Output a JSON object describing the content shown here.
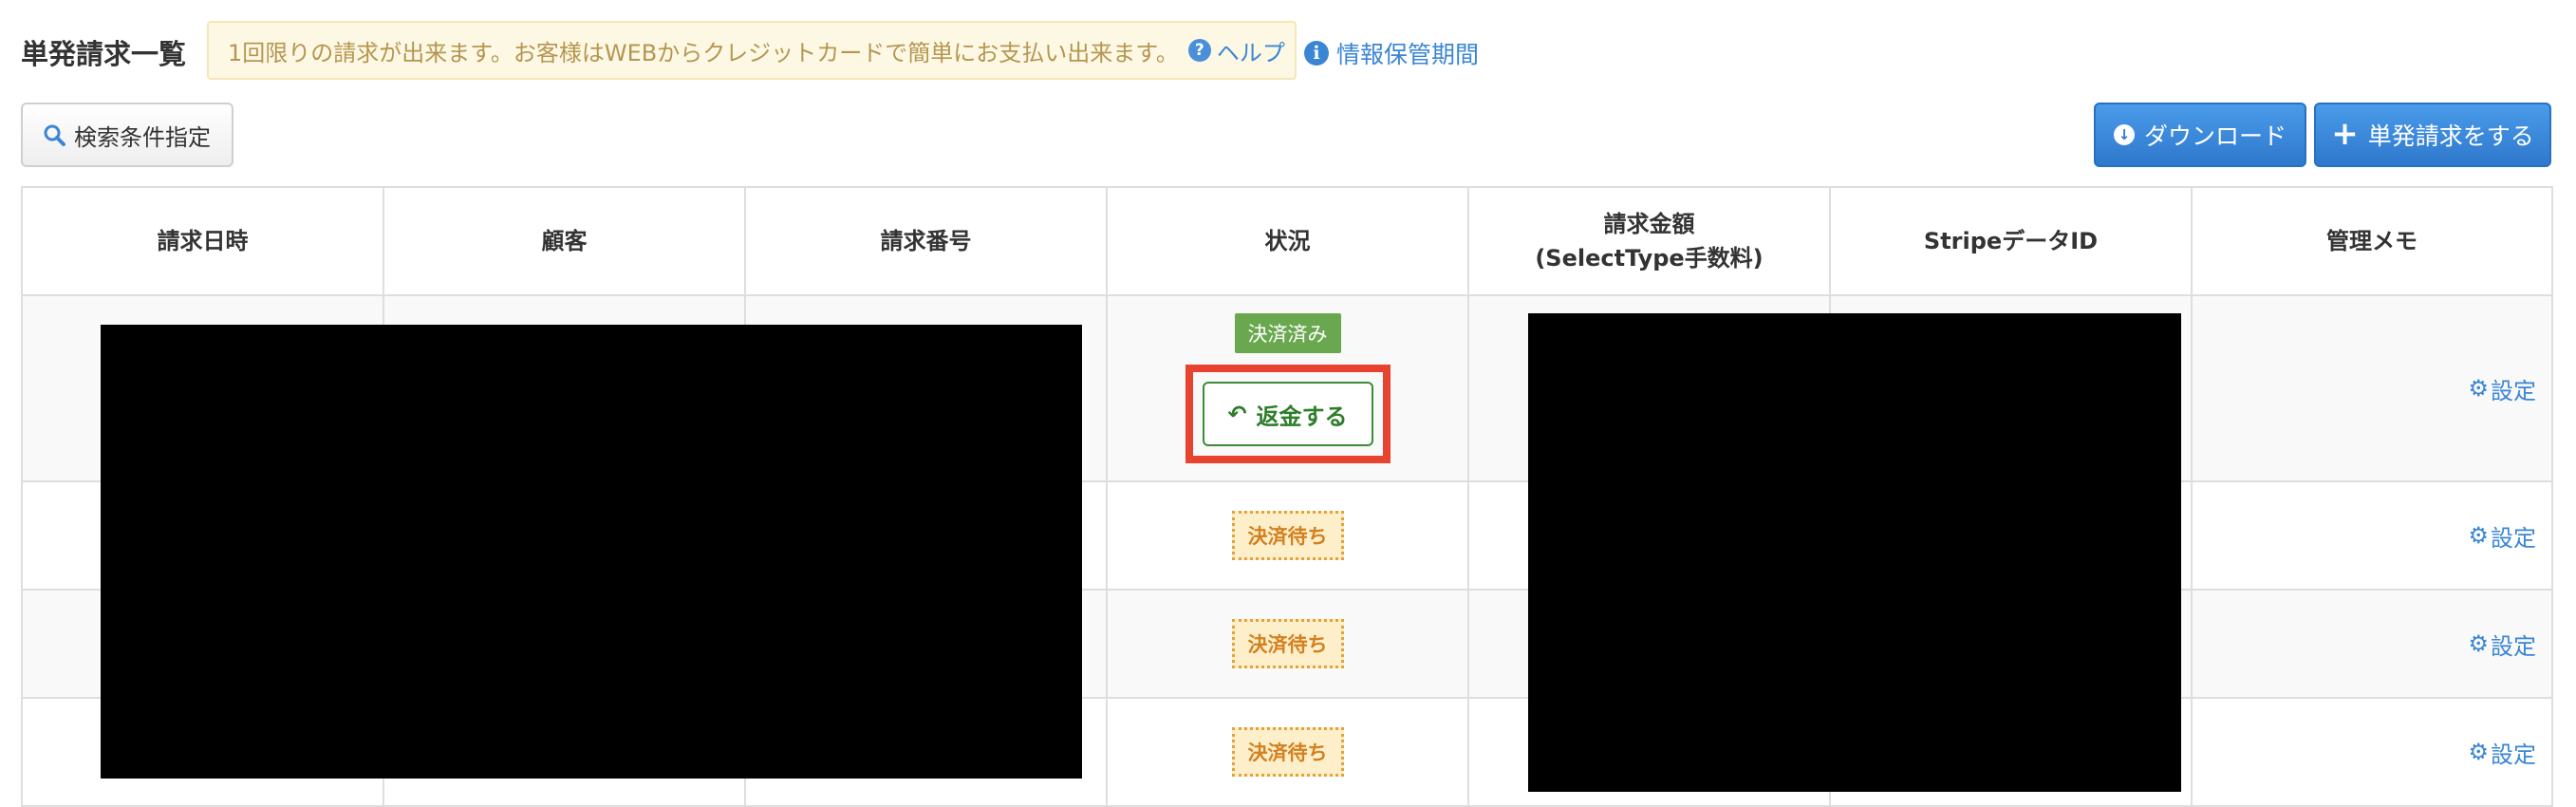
{
  "header": {
    "title": "単発請求一覧",
    "notice": "1回限りの請求が出来ます。お客様はWEBからクレジットカードで簡単にお支払い出来ます。",
    "help_label": "ヘルプ",
    "help_icon": "?",
    "info_label": "情報保管期間",
    "info_icon": "i"
  },
  "toolbar": {
    "search_label": "検索条件指定",
    "download_label": "ダウンロード",
    "new_label": "単発請求をする"
  },
  "table": {
    "headers": [
      "請求日時",
      "顧客",
      "請求番号",
      "状況",
      "請求金額",
      "(SelectType手数料)",
      "StripeデータID",
      "管理メモ"
    ],
    "rows": [
      {
        "status": "決済済み",
        "action": "返金する",
        "memo_link": "設定"
      },
      {
        "status": "決済待ち",
        "memo_link": "設定"
      },
      {
        "status": "決済待ち",
        "memo_link": "設定"
      },
      {
        "status": "決済待ち",
        "memo_link": "設定"
      }
    ]
  },
  "colors": {
    "accent_blue": "#3a86d4",
    "paid_green": "#6aa84f",
    "pending_orange": "#d4801f",
    "highlight_red": "#e8432e",
    "redaction": "#000000"
  }
}
